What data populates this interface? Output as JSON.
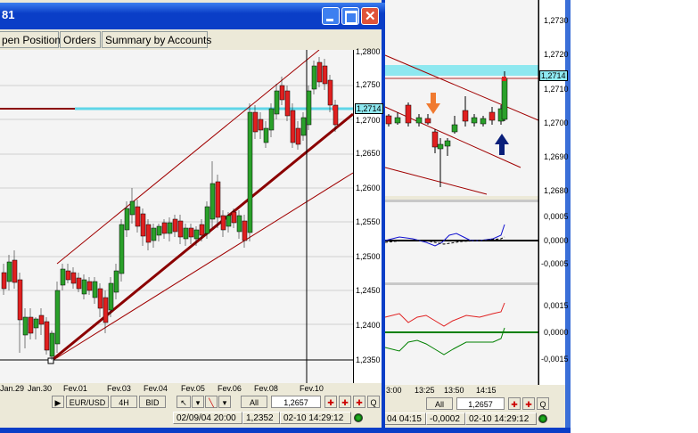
{
  "colors": {
    "title_bar": "#0a3ec7",
    "cyan_line": "#5fd6e8",
    "bull_candle": "#2aa02a",
    "bear_candle": "#e02020",
    "trend_line": "#8b0000",
    "orange_arrow": "#f07a30",
    "blue_arrow": "#0a1f7a"
  },
  "front_window": {
    "title": "81",
    "tabs": [
      "pen Positions",
      "Orders",
      "Summary by Accounts"
    ],
    "price_flag": "1,2714",
    "y_ticks": [
      "1,2800",
      "1,2750",
      "1,2700",
      "1,2650",
      "1,2600",
      "1,2550",
      "1,2500",
      "1,2450",
      "1,2400",
      "1,2350"
    ],
    "x_ticks": [
      "Jan.29",
      "Jan.30",
      "Fev.01",
      "Fev.03",
      "Fev.04",
      "Fev.05",
      "Fev.06",
      "Fev.08",
      "Fev.10"
    ],
    "toolbar": {
      "symbol": "EUR/USD",
      "timeframe": "4H",
      "price_type": "BID",
      "all": "All",
      "price": "1,2657",
      "q": "Q"
    },
    "status": {
      "datetime": "02/09/04 20:00",
      "value": "1,2352",
      "server_time": "02-10 14:29:12"
    }
  },
  "back_window": {
    "price_flag": "1,2714",
    "y_ticks": [
      "1,2730",
      "1,2720",
      "1,2710",
      "1,2700",
      "1,2690",
      "1,2680"
    ],
    "osc1_ticks": [
      "0,0005",
      "0,0000",
      "-0,0005"
    ],
    "osc2_ticks": [
      "0,0015",
      "0,0000",
      "-0,0015"
    ],
    "x_ticks": [
      "3:00",
      "13:25",
      "13:50",
      "14:15"
    ],
    "toolbar": {
      "all": "All",
      "price": "1,2657",
      "q": "Q"
    },
    "status": {
      "datetime": "04 04:15",
      "value": "-0,0002",
      "server_time": "02-10 14:29:12"
    }
  }
}
